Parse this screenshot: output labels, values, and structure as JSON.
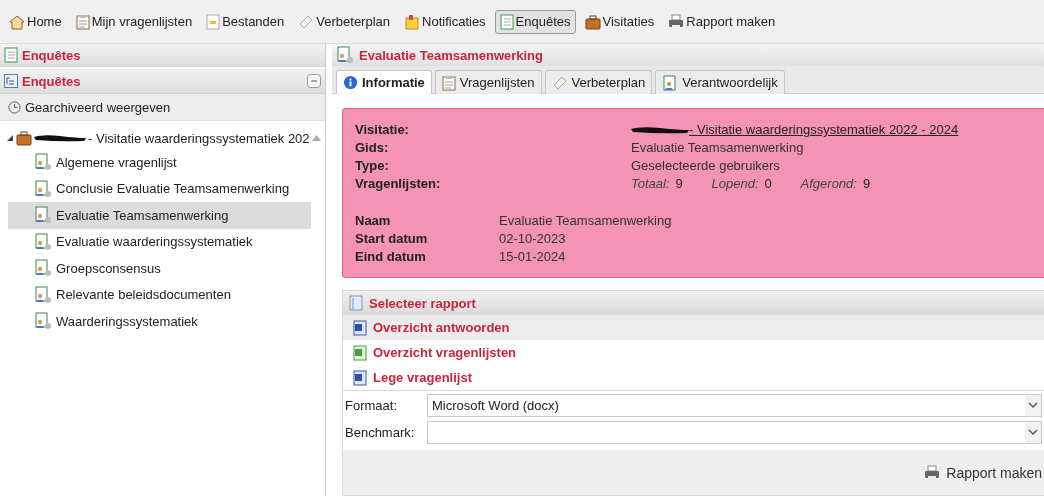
{
  "toolbar": [
    {
      "label": "Home",
      "kind": "home",
      "selected": false
    },
    {
      "label": "Mijn vragenlijsten",
      "kind": "clipboard",
      "selected": false
    },
    {
      "label": "Bestanden",
      "kind": "file",
      "selected": false
    },
    {
      "label": "Verbeterplan",
      "kind": "tag",
      "selected": false
    },
    {
      "label": "Notificaties",
      "kind": "note",
      "selected": false
    },
    {
      "label": "Enquêtes",
      "kind": "book",
      "selected": true
    },
    {
      "label": "Visitaties",
      "kind": "briefcase",
      "selected": false
    },
    {
      "label": "Rapport maken",
      "kind": "printer",
      "selected": false
    }
  ],
  "left_panel": {
    "title": "Enquêtes",
    "tree_header": "Enquêtes",
    "archive_link": "Gearchiveerd weergeven",
    "tree": [
      {
        "label": "- Visitatie waarderingssystematiek 202",
        "expanded": true,
        "children": [
          {
            "label": "Algemene vragenlijst",
            "selected": false
          },
          {
            "label": "Conclusie Evaluatie Teamsamenwerking",
            "selected": false
          },
          {
            "label": "Evaluatie Teamsamenwerking",
            "selected": true
          },
          {
            "label": "Evaluatie waarderingssystematiek",
            "selected": false
          },
          {
            "label": "Groepsconsensus",
            "selected": false
          },
          {
            "label": "Relevante beleidsdocumenten",
            "selected": false
          },
          {
            "label": "Waarderingssystematiek",
            "selected": false
          }
        ]
      }
    ]
  },
  "detail": {
    "title": "Evaluatie Teamsamenwerking",
    "tabs": [
      {
        "label": "Informatie",
        "kind": "info",
        "selected": true
      },
      {
        "label": "Vragenlijsten",
        "kind": "clipboard",
        "selected": false
      },
      {
        "label": "Verbeterplan",
        "kind": "tag",
        "selected": false
      },
      {
        "label": "Verantwoordelijk",
        "kind": "person",
        "selected": false
      }
    ],
    "info": {
      "visitatie": {
        "label": "Visitatie:",
        "value": "- Visitatie waarderingssystematiek 2022 - 2024"
      },
      "gids": {
        "label": "Gids:",
        "value": "Evaluatie Teamsamenwerking"
      },
      "type": {
        "label": "Type:",
        "value": "Geselecteerde gebruikers"
      },
      "vragenlijsten": {
        "label": "Vragenlijsten:",
        "counts": [
          {
            "label": "Totaal:",
            "value": "9"
          },
          {
            "label": "Lopend:",
            "value": "0"
          },
          {
            "label": "Afgerond:",
            "value": "9"
          }
        ]
      },
      "details": [
        {
          "label": "Naam",
          "value": "Evaluatie Teamsamenwerking"
        },
        {
          "label": "Start datum",
          "value": "02-10-2023"
        },
        {
          "label": "Eind datum",
          "value": "15-01-2024"
        }
      ]
    },
    "report": {
      "title": "Selecteer rapport",
      "items": [
        {
          "label": "Overzicht antwoorden",
          "kind": "word",
          "selected": true
        },
        {
          "label": "Overzicht vragenlijsten",
          "kind": "excel",
          "selected": false
        },
        {
          "label": "Lege vragenlijst",
          "kind": "word",
          "selected": false
        }
      ],
      "fields": [
        {
          "label": "Formaat:",
          "value": "Microsoft Word (docx)"
        },
        {
          "label": "Benchmark:"
        }
      ],
      "button": "Rapport maken"
    }
  }
}
